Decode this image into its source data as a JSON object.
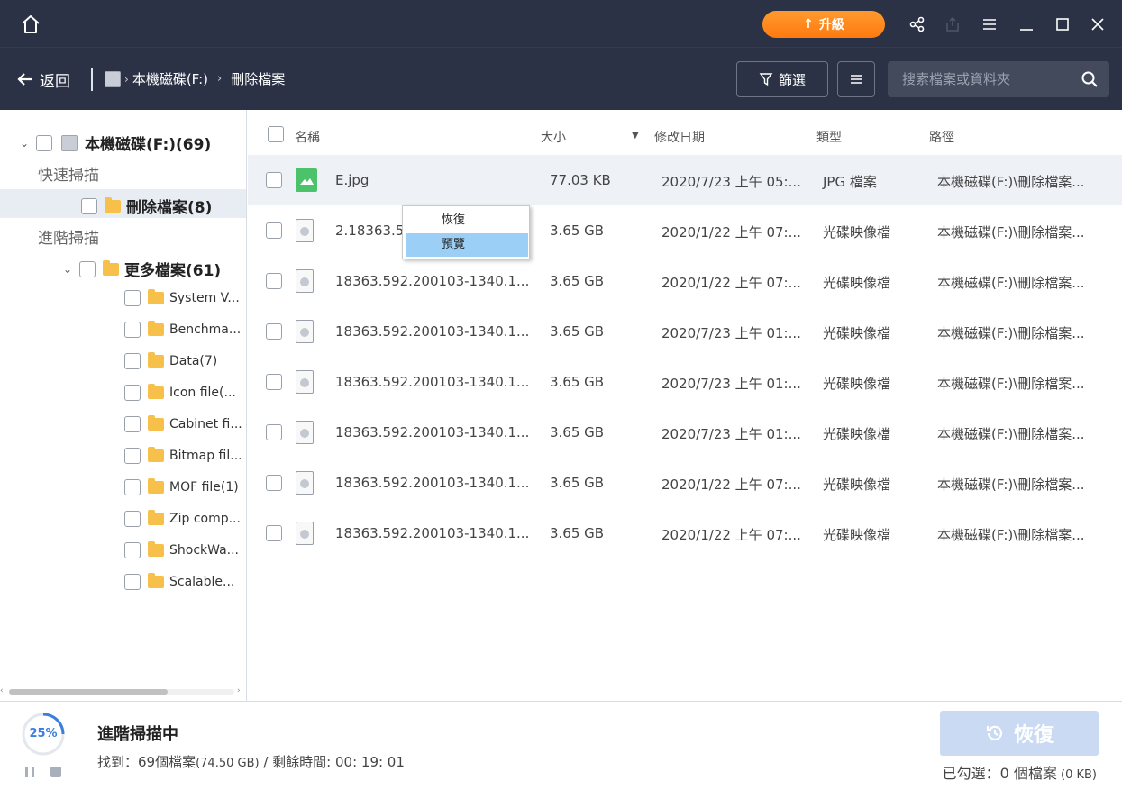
{
  "titlebar": {
    "upgrade_label": "升級"
  },
  "nav": {
    "back_label": "返回",
    "drive_label": "本機磁碟(F:)",
    "folder_label": "刪除檔案",
    "filter_label": "篩選",
    "search_placeholder": "搜索檔案或資料夾"
  },
  "tree": {
    "root_label": "本機磁碟(F:)(69)",
    "quick_scan_label": "快速掃描",
    "deleted_files_label": "刪除檔案(8)",
    "advanced_scan_label": "進階掃描",
    "more_files_label": "更多檔案(61)",
    "children": [
      "System V...",
      "Benchma...",
      "Data(7)",
      "Icon file(...",
      "Cabinet fi...",
      "Bitmap fil...",
      "MOF file(1)",
      "Zip comp...",
      "ShockWa...",
      "Scalable..."
    ]
  },
  "list": {
    "headers": {
      "name": "名稱",
      "size": "大小",
      "date": "修改日期",
      "type": "類型",
      "path": "路徑"
    },
    "rows": [
      {
        "name": "E.jpg",
        "size": "77.03 KB",
        "date": "2020/7/23 上午 05:...",
        "type": "JPG 檔案",
        "path": "本機磁碟(F:)\\刪除檔案..."
      },
      {
        "name": "2.18363.5",
        "size": "3.65 GB",
        "date": "2020/1/22 上午 07:...",
        "type": "光碟映像檔",
        "path": "本機磁碟(F:)\\刪除檔案..."
      },
      {
        "name": "18363.592.200103-1340.1...",
        "size": "3.65 GB",
        "date": "2020/1/22 上午 07:...",
        "type": "光碟映像檔",
        "path": "本機磁碟(F:)\\刪除檔案..."
      },
      {
        "name": "18363.592.200103-1340.1...",
        "size": "3.65 GB",
        "date": "2020/7/23 上午 01:...",
        "type": "光碟映像檔",
        "path": "本機磁碟(F:)\\刪除檔案..."
      },
      {
        "name": "18363.592.200103-1340.1...",
        "size": "3.65 GB",
        "date": "2020/7/23 上午 01:...",
        "type": "光碟映像檔",
        "path": "本機磁碟(F:)\\刪除檔案..."
      },
      {
        "name": "18363.592.200103-1340.1...",
        "size": "3.65 GB",
        "date": "2020/7/23 上午 01:...",
        "type": "光碟映像檔",
        "path": "本機磁碟(F:)\\刪除檔案..."
      },
      {
        "name": "18363.592.200103-1340.1...",
        "size": "3.65 GB",
        "date": "2020/1/22 上午 07:...",
        "type": "光碟映像檔",
        "path": "本機磁碟(F:)\\刪除檔案..."
      },
      {
        "name": "18363.592.200103-1340.1...",
        "size": "3.65 GB",
        "date": "2020/1/22 上午 07:...",
        "type": "光碟映像檔",
        "path": "本機磁碟(F:)\\刪除檔案..."
      }
    ]
  },
  "context_menu": {
    "recover_label": "恢復",
    "preview_label": "預覽"
  },
  "status": {
    "progress_percent": "25%",
    "progress_fraction": 0.25,
    "scan_title": "進階掃描中",
    "found_prefix": "找到：69個檔案",
    "found_size": "(74.50 GB)",
    "remaining": " / 剩餘時間: 00: 19: 01",
    "recover_button_label": "恢復",
    "selected_prefix": "已勾選：0 個檔案",
    "selected_size": " (0 KB)"
  },
  "colors": {
    "titlebar_bg": "#2b3245",
    "accent_orange": "#ff8a1f",
    "progress_blue": "#3b7fdc",
    "context_highlight": "#9ccff5",
    "recover_disabled": "#c9daf2"
  }
}
